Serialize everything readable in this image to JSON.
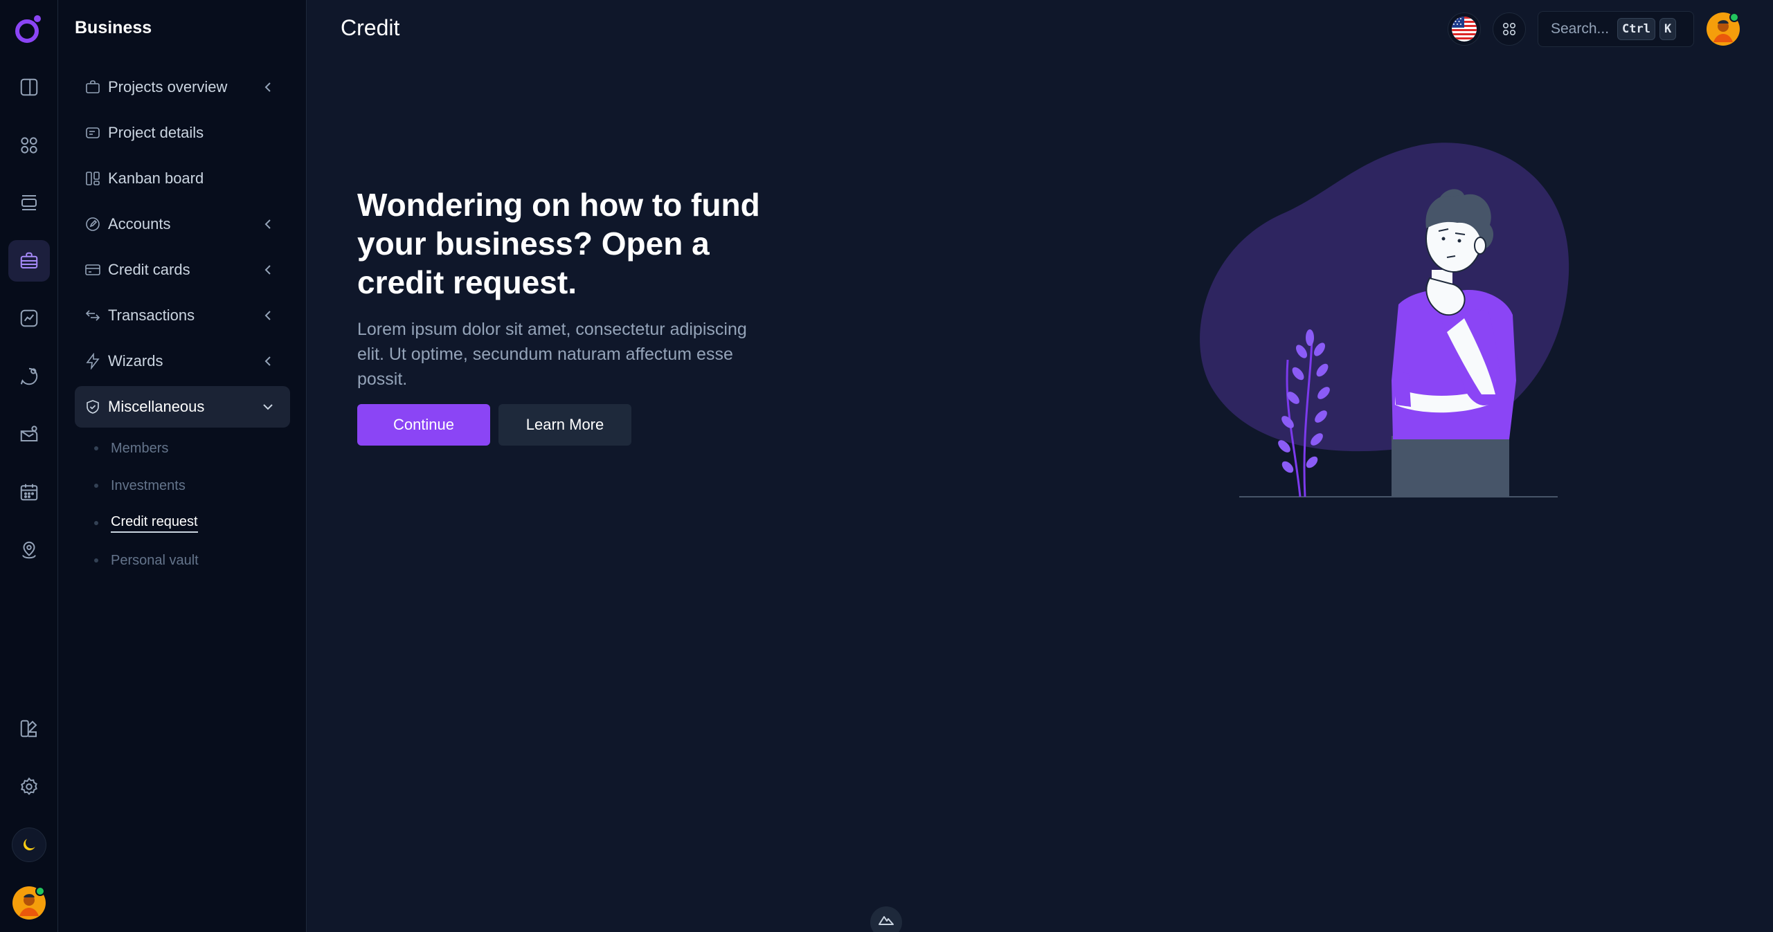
{
  "app": {
    "section_title": "Business",
    "page_title": "Credit"
  },
  "rail": {
    "items": [
      {
        "icon": "sidebar-panel-icon"
      },
      {
        "icon": "dashboard-grid-icon"
      },
      {
        "icon": "layout-list-icon"
      },
      {
        "icon": "briefcase-icon",
        "active": true
      },
      {
        "icon": "analytics-chart-icon"
      },
      {
        "icon": "chat-bubble-icon"
      },
      {
        "icon": "mailbox-icon"
      },
      {
        "icon": "calendar-icon"
      },
      {
        "icon": "map-pin-icon"
      }
    ],
    "bottom": [
      {
        "icon": "customizer-icon"
      },
      {
        "icon": "settings-gear-icon"
      }
    ],
    "theme_icon": "moon-icon"
  },
  "sidebar": {
    "items": [
      {
        "label": "Projects overview",
        "icon": "briefcase-icon",
        "chevron": true
      },
      {
        "label": "Project details",
        "icon": "card-text-icon",
        "chevron": false
      },
      {
        "label": "Kanban board",
        "icon": "kanban-icon",
        "chevron": false
      },
      {
        "label": "Accounts",
        "icon": "edit-circle-icon",
        "chevron": true
      },
      {
        "label": "Credit cards",
        "icon": "credit-card-icon",
        "chevron": true
      },
      {
        "label": "Transactions",
        "icon": "arrows-swap-icon",
        "chevron": true
      },
      {
        "label": "Wizards",
        "icon": "lightning-icon",
        "chevron": true
      },
      {
        "label": "Miscellaneous",
        "icon": "shield-check-icon",
        "chevron": true,
        "expanded": true
      }
    ],
    "sub_items": [
      {
        "label": "Members"
      },
      {
        "label": "Investments"
      },
      {
        "label": "Credit request",
        "active": true
      },
      {
        "label": "Personal vault"
      }
    ]
  },
  "header": {
    "search_placeholder": "Search...",
    "kbd_ctrl": "Ctrl",
    "kbd_k": "K"
  },
  "hero": {
    "title": "Wondering on how to fund your business? Open a credit request.",
    "text": "Lorem ipsum dolor sit amet, consectetur adipiscing elit. Ut optime, secundum naturam affectum esse possit.",
    "primary_button": "Continue",
    "secondary_button": "Learn More"
  },
  "colors": {
    "accent": "#8b45f5",
    "background": "#0f172a",
    "sidebar": "#070d1c",
    "blob": "#2e2560",
    "plant": "#8b5cf6"
  }
}
